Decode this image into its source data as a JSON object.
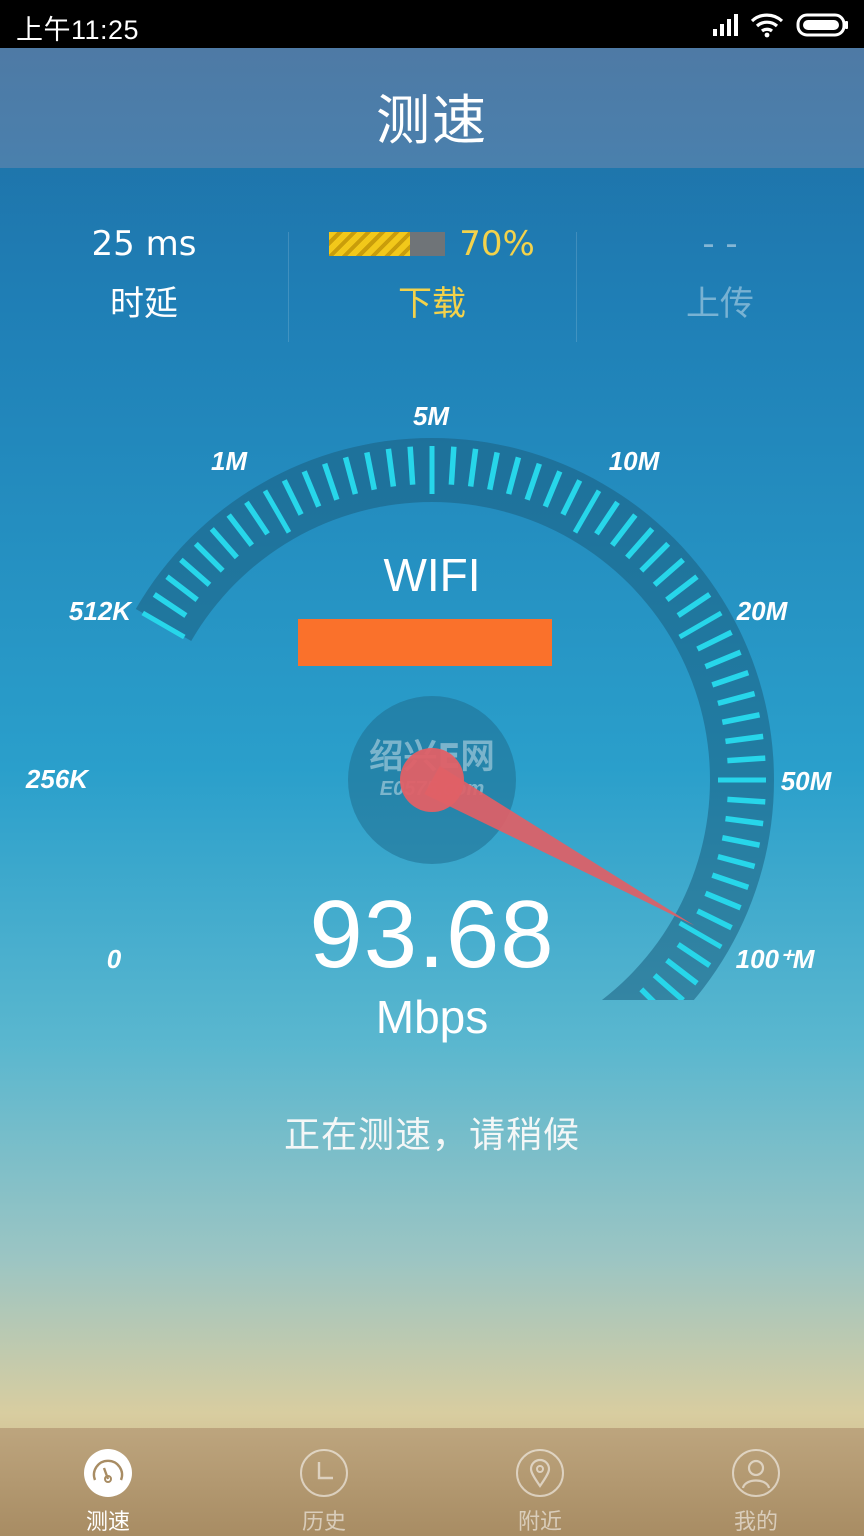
{
  "status_bar": {
    "time": "上午11:25"
  },
  "header": {
    "title": "测速"
  },
  "stats": {
    "latency": {
      "value": "25 ms",
      "label": "时延"
    },
    "download": {
      "progress_text": "70%",
      "progress": 0.7,
      "label": "下载"
    },
    "upload": {
      "value": "- -",
      "label": "上传"
    }
  },
  "gauge": {
    "labels": [
      "0",
      "256K",
      "512K",
      "1M",
      "5M",
      "10M",
      "20M",
      "50M",
      "100⁺M"
    ],
    "network_type": "WIFI",
    "speed_value": "93.68",
    "speed_unit": "Mbps"
  },
  "status_message": "正在测速，请稍候",
  "watermark": {
    "line1": "绍兴E网",
    "line2": "E0575.com"
  },
  "tabs": [
    {
      "label": "测速",
      "icon": "speedometer-icon",
      "active": true
    },
    {
      "label": "历史",
      "icon": "clock-icon",
      "active": false
    },
    {
      "label": "附近",
      "icon": "location-pin-icon",
      "active": false
    },
    {
      "label": "我的",
      "icon": "user-icon",
      "active": false
    }
  ],
  "colors": {
    "accent_yellow": "#f3d24b",
    "tick_cyan": "#27d6ea",
    "needle_red": "#e06066",
    "redaction_orange": "#fa712b"
  }
}
